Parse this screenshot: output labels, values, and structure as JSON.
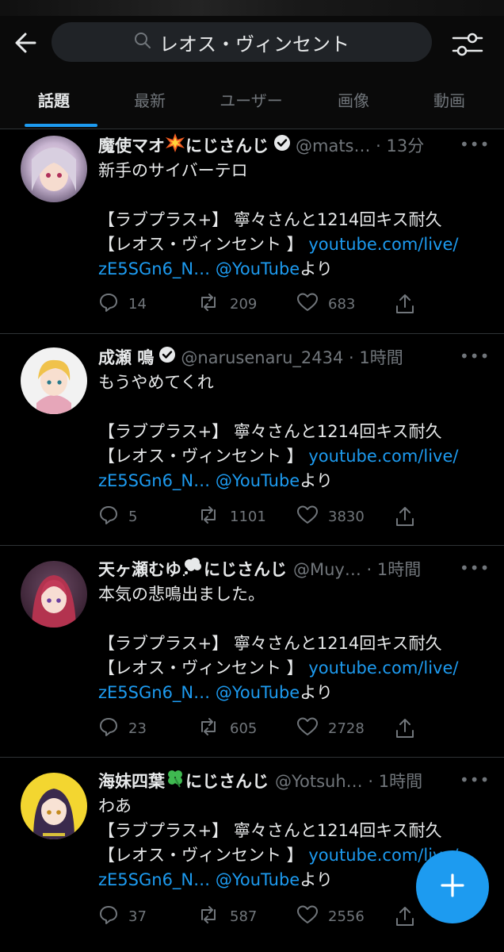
{
  "search": {
    "query": "レオス・ヴィンセント"
  },
  "icons": {
    "back": "back-arrow-icon",
    "filter": "filter-sliders-icon",
    "search": "search-icon",
    "compose": "compose-plus-icon"
  },
  "colors": {
    "background": "#000000",
    "accent": "#1d9bf0",
    "muted": "#71767b",
    "text": "#e7e9ea"
  },
  "tabs": [
    {
      "label": "話題",
      "active": true
    },
    {
      "label": "最新"
    },
    {
      "label": "ユーザー"
    },
    {
      "label": "画像"
    },
    {
      "label": "動画"
    }
  ],
  "tweets": [
    {
      "name": "魔使マオ",
      "name_suffix": "にじさんじ",
      "emoji": "collision",
      "handle": "@mats…",
      "time": "13分",
      "text": "新手のサイバーテロ",
      "quote1": "【ラブプラス+】 寧々さんと1214回キス耐久",
      "quote2": "【レオス・ヴィンセント 】",
      "link": "youtube.com/live/",
      "link2": "zE5SGn6_N…",
      "via": "@YouTube",
      "yori": "より",
      "replies": "14",
      "retweets": "209",
      "likes": "683"
    },
    {
      "name": "成瀬 鳴",
      "name_suffix": "",
      "handle": "@narusenaru_2434",
      "time": "1時間",
      "text": "もうやめてくれ",
      "quote1": "【ラブプラス+】 寧々さんと1214回キス耐久",
      "quote2": "【レオス・ヴィンセント 】",
      "link": "youtube.com/live/",
      "link2": "zE5SGn6_N…",
      "via": "@YouTube",
      "yori": "より",
      "replies": "5",
      "retweets": "1101",
      "likes": "3830"
    },
    {
      "name": "天ヶ瀬むゆ",
      "name_suffix": "にじさんじ",
      "emoji": "thought-bubble",
      "handle": "@Muy…",
      "time": "1時間",
      "text": "本気の悲鳴出ました。",
      "quote1": "【ラブプラス+】 寧々さんと1214回キス耐久",
      "quote2": "【レオス・ヴィンセント 】",
      "link": "youtube.com/live/",
      "link2": "zE5SGn6_N…",
      "via": "@YouTube",
      "yori": "より",
      "replies": "23",
      "retweets": "605",
      "likes": "2728"
    },
    {
      "name": "海妹四葉",
      "name_suffix": "にじさんじ",
      "emoji": "four-leaf-clover",
      "handle": "@Yotsuh…",
      "time": "1時間",
      "text": "わあ",
      "quote1": "【ラブプラス+】 寧々さんと1214回キス耐久",
      "quote2": "【レオス・ヴィンセント 】",
      "link": "youtube.com/live/",
      "link2": "zE5SGn6_N…",
      "via": "@YouTube",
      "yori": "より",
      "replies": "37",
      "retweets": "587",
      "likes": "2556"
    }
  ]
}
